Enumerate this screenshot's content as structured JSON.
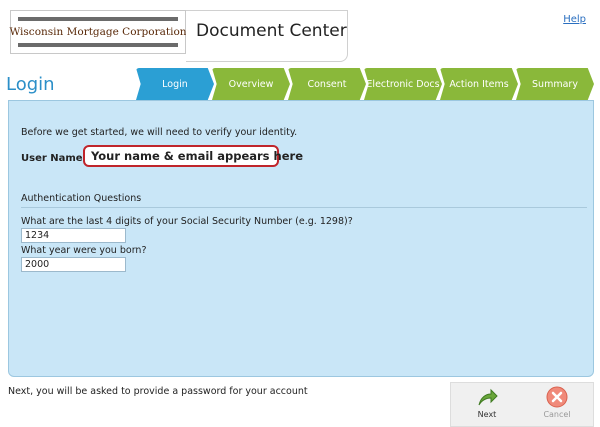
{
  "header": {
    "logo_text": "Wisconsin Mortgage Corporation",
    "app_title": "Document Center",
    "help_label": "Help"
  },
  "page": {
    "heading": "Login"
  },
  "tabs": [
    {
      "label": "Login",
      "active": true
    },
    {
      "label": "Overview",
      "active": false
    },
    {
      "label": "Consent",
      "active": false
    },
    {
      "label": "Electronic Docs",
      "active": false
    },
    {
      "label": "Action Items",
      "active": false
    },
    {
      "label": "Summary",
      "active": false
    }
  ],
  "form": {
    "intro": "Before we get started, we will need to verify your identity.",
    "username_label": "User Name:",
    "username_value": "Your name & email appears here",
    "auth_title": "Authentication Questions",
    "q1": "What are the last 4 digits of your Social Security Number (e.g. 1298)?",
    "a1": "1234",
    "q2": "What year were you born?",
    "a2": "2000"
  },
  "footer": {
    "note": "Next, you will be asked to provide a password for your account",
    "next_label": "Next",
    "cancel_label": "Cancel"
  },
  "colors": {
    "tab_active": "#2b9fd4",
    "tab_inactive": "#8ab83a",
    "panel_bg": "#c9e6f7",
    "highlight_border": "#c0252b"
  }
}
